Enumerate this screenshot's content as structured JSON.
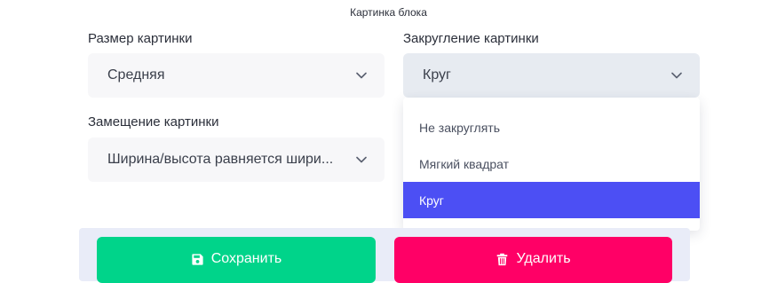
{
  "header": {
    "title": "Картинка блока"
  },
  "size_field": {
    "label": "Размер картинки",
    "value": "Средняя",
    "icon": "chevron-down-icon"
  },
  "rounding_field": {
    "label": "Закругление картинки",
    "value": "Круг",
    "icon": "chevron-down-icon",
    "expanded": true,
    "options": [
      {
        "label": "Не закруглять",
        "selected": false
      },
      {
        "label": "Мягкий квадрат",
        "selected": false
      },
      {
        "label": "Круг",
        "selected": true
      }
    ]
  },
  "fit_field": {
    "label": "Замещение картинки",
    "value": "Ширина/высота равняется шири...",
    "icon": "chevron-down-icon"
  },
  "actions": {
    "save_label": "Сохранить",
    "save_icon": "floppy-disk-icon",
    "delete_label": "Удалить",
    "delete_icon": "trash-icon"
  },
  "colors": {
    "accent": "#4c4ff4",
    "save": "#00d48a",
    "delete": "#ff0066"
  }
}
